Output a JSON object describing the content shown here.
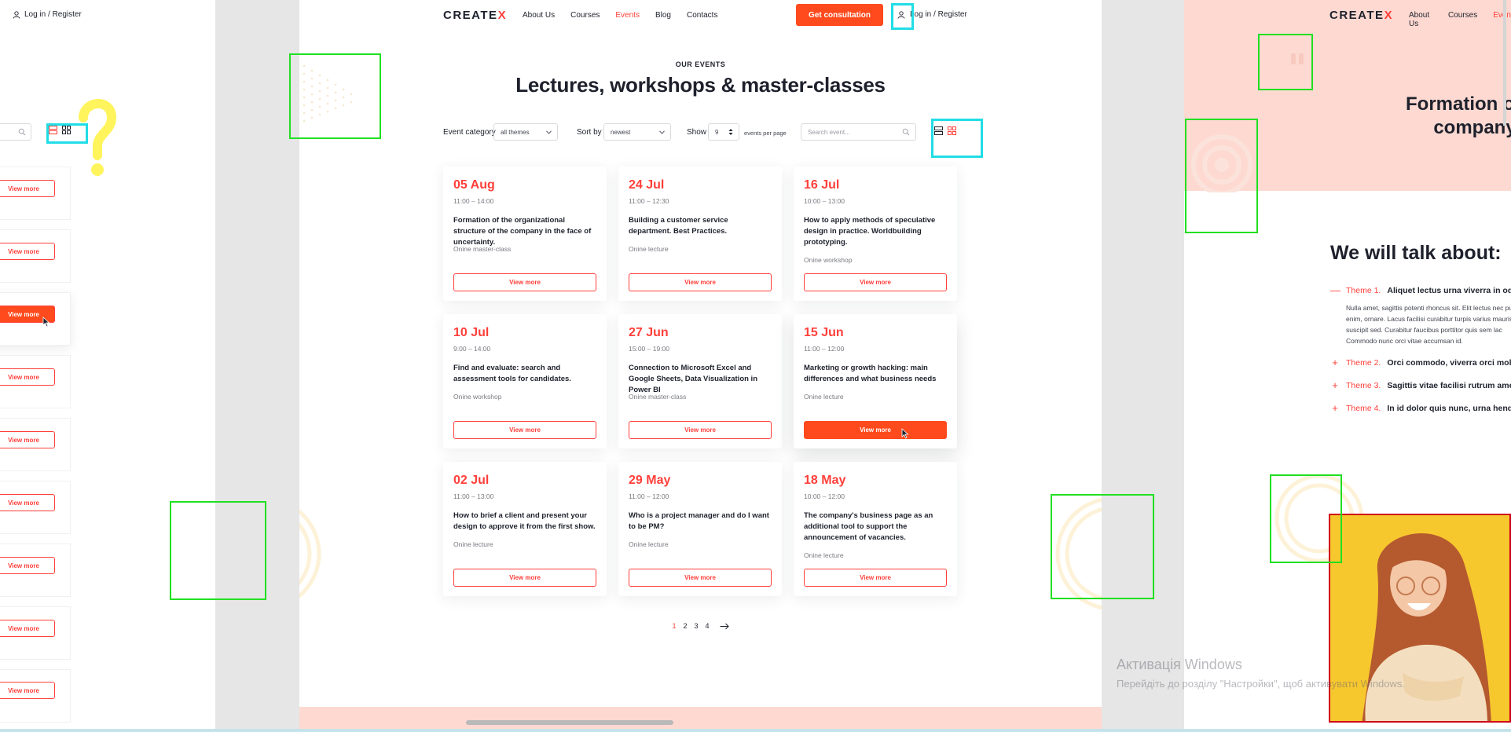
{
  "brand": {
    "logo_text": "CREATE",
    "logo_accent": "X",
    "accent_color": "#ff3f3a",
    "button_color": "#ff4a1d"
  },
  "header": {
    "nav": [
      "About Us",
      "Courses",
      "Events",
      "Blog",
      "Contacts"
    ],
    "active_nav": "Events",
    "consult_label": "Get consultation",
    "login_label": "Log in / Register"
  },
  "section": {
    "label": "OUR EVENTS",
    "title": "Lectures, workshops & master-classes"
  },
  "filters": {
    "category_label": "Event category",
    "category_value": "all themes",
    "sort_label": "Sort by",
    "sort_value": "newest",
    "show_label": "Show",
    "show_value": "9",
    "per_page_label": "events per page",
    "search_placeholder": "Search event..."
  },
  "events": [
    {
      "date": "05 Aug",
      "time": "11:00 – 14:00",
      "title": "Formation of the organizational structure of the company in the face of uncertainty.",
      "type": "Onine master-class",
      "button": "View more"
    },
    {
      "date": "24 Jul",
      "time": "11:00 – 12:30",
      "title": "Building a customer service department. Best Practices.",
      "type": "Onine lecture",
      "button": "View more"
    },
    {
      "date": "16 Jul",
      "time": "10:00 – 13:00",
      "title": "How to apply methods of speculative design in practice. Worldbuilding prototyping.",
      "type": "Onine workshop",
      "button": "View more"
    },
    {
      "date": "10 Jul",
      "time": "9:00 – 14:00",
      "title": "Find and evaluate: search and assessment tools for candidates.",
      "type": "Onine workshop",
      "button": "View more"
    },
    {
      "date": "27 Jun",
      "time": "15:00 – 19:00",
      "title": "Connection to Microsoft Excel and Google Sheets, Data Visualization in Power BI",
      "type": "Onine master-class",
      "button": "View more"
    },
    {
      "date": "15 Jun",
      "time": "11:00 – 12:00",
      "title": "Marketing or growth hacking: main differences and what business needs",
      "type": "Onine  lecture",
      "button": "View more"
    },
    {
      "date": "02 Jul",
      "time": "11:00 – 13:00",
      "title": "How to brief a client and present your design to approve it from the first show.",
      "type": "Onine lecture",
      "button": "View more"
    },
    {
      "date": "29 May",
      "time": "11:00 – 12:00",
      "title": "Who is a project manager and do I want to be PM?",
      "type": "Onine lecture",
      "button": "View more"
    },
    {
      "date": "18 May",
      "time": "10:00 – 12:00",
      "title": "The company's business page as an additional tool to support the announcement of vacancies.",
      "type": "Onine lecture",
      "button": "View more"
    }
  ],
  "pagination": {
    "pages": [
      "1",
      "2",
      "3",
      "4"
    ],
    "current": "1"
  },
  "left_panel": {
    "login_label": "Log in / Register",
    "buttons": [
      "View more",
      "View more",
      "View more",
      "View more",
      "View more",
      "View more",
      "View more",
      "View more",
      "View more"
    ]
  },
  "right_panel": {
    "nav": [
      "About Us",
      "Courses",
      "Even"
    ],
    "title": "Formation of th company",
    "talk_heading": "We will talk about:",
    "themes": [
      {
        "num": "Theme 1.",
        "title": "Aliquet lectus urna viverra in odio",
        "open": true
      },
      {
        "num": "Theme 2.",
        "title": "Orci commodo, viverra orci mollis",
        "open": false
      },
      {
        "num": "Theme 3.",
        "title": "Sagittis vitae facilisi rutrum amet",
        "open": false
      },
      {
        "num": "Theme 4.",
        "title": "In id dolor quis nunc, urna hendre",
        "open": false
      }
    ],
    "theme_body": "Nulla amet, sagittis potenti rhoncus sit. Elit lectus nec pu enim, ornare. Lacus facilisi curabitur turpis varius mauris mi suscipit sed. Curabitur faucibus porttitor quis sem lac Commodo nunc orci vitae accumsan id."
  },
  "watermark": {
    "title": "Активація Windows",
    "subtitle": "Перейдіть до розділу \"Настройки\", щоб активувати Windows."
  }
}
